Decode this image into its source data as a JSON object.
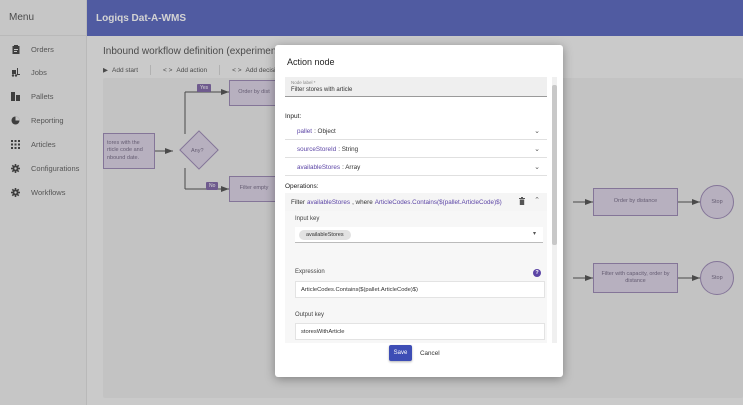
{
  "sidebar": {
    "header": "Menu",
    "items": [
      {
        "label": "Orders",
        "icon": "clipboard-icon"
      },
      {
        "label": "Jobs",
        "icon": "forklift-icon"
      },
      {
        "label": "Pallets",
        "icon": "pallet-icon"
      },
      {
        "label": "Reporting",
        "icon": "pie-chart-icon"
      },
      {
        "label": "Articles",
        "icon": "grid-icon"
      },
      {
        "label": "Configurations",
        "icon": "gear-icon"
      },
      {
        "label": "Workflows",
        "icon": "gear-icon"
      }
    ]
  },
  "app": {
    "title": "Logiqs Dat-A-WMS"
  },
  "main": {
    "title": "Inbound workflow definition (experimental)",
    "toolbar": {
      "add_start": "Add start",
      "add_action": "Add action",
      "add_decision": "Add decision"
    }
  },
  "flow": {
    "node_stores": "tores with the rticle code and nbound date.",
    "node_any": "Any?",
    "tag_yes": "Yes",
    "tag_no": "No",
    "node_order_top": "Order by dist",
    "node_filter_empty": "Filter empty",
    "node_order_distance": "Order by distance",
    "node_filter_capacity": "Filter with capacity, order by distance",
    "stop_1": "Stop",
    "stop_2": "Stop"
  },
  "dialog": {
    "title": "Action node",
    "node_label_label": "Node label *",
    "node_label_value": "Filter stores with article",
    "input_label": "Input:",
    "inputs": [
      {
        "key": "pallet",
        "type": ": Object"
      },
      {
        "key": "sourceStoreId",
        "type": ": String"
      },
      {
        "key": "availableStores",
        "type": ": Array"
      }
    ],
    "operations_label": "Operations:",
    "operation": {
      "prefix": "Filter",
      "target": "availableStores",
      "middle": ", where",
      "expr": "ArticleCodes.Contains($(pallet.ArticleCode)$)",
      "input_key_label": "Input key",
      "input_key_value": "availableStores",
      "expression_label": "Expression",
      "expression_value": "ArticleCodes.Contains($(pallet.ArticleCode)$)",
      "output_key_label": "Output key",
      "output_key_value": "storesWithArticle"
    },
    "save_label": "Save",
    "cancel_label": "Cancel"
  },
  "colors": {
    "primary": "#3d4db5",
    "accent": "#5c45a6",
    "node_fill": "#d5cbe2",
    "node_border": "#8a74a8"
  }
}
